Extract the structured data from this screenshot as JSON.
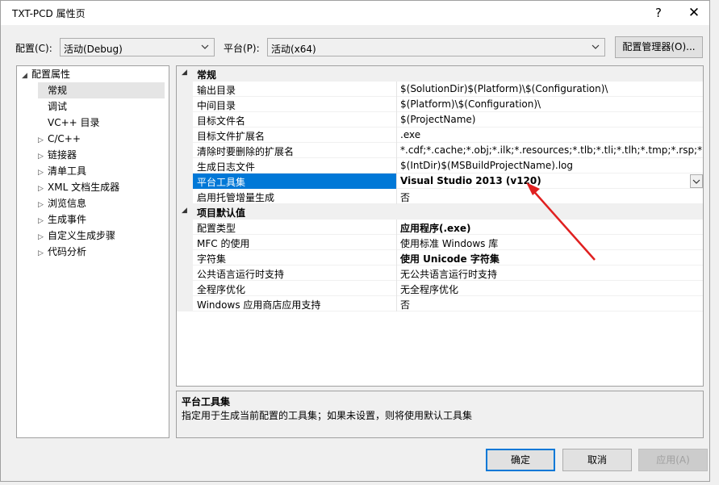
{
  "window": {
    "title": "TXT-PCD 属性页",
    "help_label": "?",
    "close_label": "✕"
  },
  "config_bar": {
    "config_label": "配置(C):",
    "config_value": "活动(Debug)",
    "platform_label": "平台(P):",
    "platform_value": "活动(x64)",
    "manager_button": "配置管理器(O)..."
  },
  "tree": {
    "root": "配置属性",
    "items": [
      {
        "label": "常规",
        "expandable": false,
        "selected": true
      },
      {
        "label": "调试",
        "expandable": false
      },
      {
        "label": "VC++ 目录",
        "expandable": false
      },
      {
        "label": "C/C++",
        "expandable": true
      },
      {
        "label": "链接器",
        "expandable": true
      },
      {
        "label": "清单工具",
        "expandable": true
      },
      {
        "label": "XML 文档生成器",
        "expandable": true
      },
      {
        "label": "浏览信息",
        "expandable": true
      },
      {
        "label": "生成事件",
        "expandable": true
      },
      {
        "label": "自定义生成步骤",
        "expandable": true
      },
      {
        "label": "代码分析",
        "expandable": true
      }
    ]
  },
  "grid": {
    "category_general": "常规",
    "rows_general": [
      {
        "name": "输出目录",
        "value": "$(SolutionDir)$(Platform)\\$(Configuration)\\"
      },
      {
        "name": "中间目录",
        "value": "$(Platform)\\$(Configuration)\\"
      },
      {
        "name": "目标文件名",
        "value": "$(ProjectName)"
      },
      {
        "name": "目标文件扩展名",
        "value": ".exe"
      },
      {
        "name": "清除时要删除的扩展名",
        "value": "*.cdf;*.cache;*.obj;*.ilk;*.resources;*.tlb;*.tli;*.tlh;*.tmp;*.rsp;*.pgc;*.p"
      },
      {
        "name": "生成日志文件",
        "value": "$(IntDir)$(MSBuildProjectName).log"
      },
      {
        "name": "平台工具集",
        "value": "Visual Studio 2013 (v120)"
      },
      {
        "name": "启用托管增量生成",
        "value": "否"
      }
    ],
    "category_defaults": "项目默认值",
    "rows_defaults": [
      {
        "name": "配置类型",
        "value": "应用程序(.exe)"
      },
      {
        "name": "MFC 的使用",
        "value": "使用标准 Windows 库"
      },
      {
        "name": "字符集",
        "value": "使用 Unicode 字符集"
      },
      {
        "name": "公共语言运行时支持",
        "value": "无公共语言运行时支持"
      },
      {
        "name": "全程序优化",
        "value": "无全程序优化"
      },
      {
        "name": "Windows 应用商店应用支持",
        "value": "否"
      }
    ]
  },
  "description": {
    "title": "平台工具集",
    "text": "指定用于生成当前配置的工具集；如果未设置，则将使用默认工具集"
  },
  "buttons": {
    "ok": "确定",
    "cancel": "取消",
    "apply": "应用(A)"
  },
  "colors": {
    "selection": "#0078d7",
    "annotation_arrow": "#e02020"
  }
}
